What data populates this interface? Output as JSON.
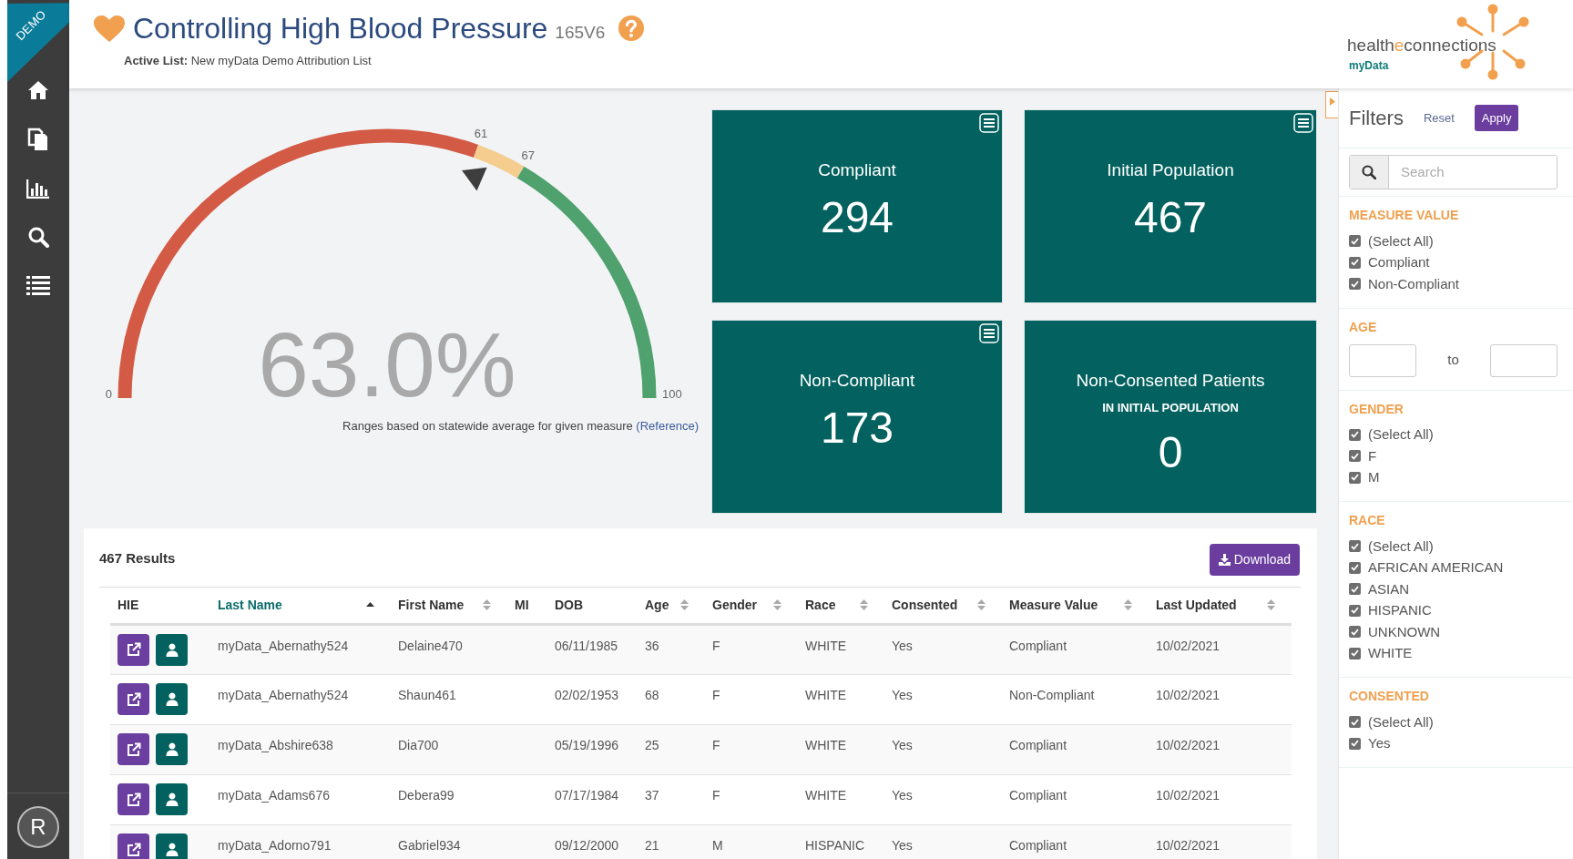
{
  "ribbon": "DEMO",
  "header": {
    "title": "Controlling High Blood Pressure",
    "code": "165V6",
    "active_list_label": "Active List:",
    "active_list": "New myData Demo Attribution List"
  },
  "logo": {
    "parts": [
      "health",
      "e",
      "connections"
    ],
    "sub": "myData"
  },
  "user": {
    "initial": "R"
  },
  "gauge": {
    "value_text": "63.0%",
    "level": 0.63,
    "start_label": "0",
    "bands": [
      {
        "end": "61",
        "color": "#d35a45"
      },
      {
        "end": "67",
        "color": "#f4cd8f"
      },
      {
        "end": "100",
        "color": "#4fa16d"
      }
    ],
    "caption": "Ranges based on statewide average for given measure",
    "link": "(Reference)"
  },
  "tiles": [
    {
      "label": "Compliant",
      "value": "294",
      "menu": true
    },
    {
      "label": "Initial Population",
      "value": "467",
      "menu": true
    },
    {
      "label": "Non-Compliant",
      "value": "173",
      "menu": true
    },
    {
      "label": "Non-Consented Patients",
      "sublabel": "IN INITIAL POPULATION",
      "value": "0",
      "menu": false
    }
  ],
  "results": {
    "count": "467 Results",
    "download": "Download"
  },
  "table": {
    "columns": [
      {
        "label": "HIE",
        "sortable": false,
        "sorted": false
      },
      {
        "label": "Last Name",
        "sortable": true,
        "sorted": true
      },
      {
        "label": "First Name",
        "sortable": true,
        "sorted": false
      },
      {
        "label": "MI",
        "sortable": false,
        "sorted": false
      },
      {
        "label": "DOB",
        "sortable": false,
        "sorted": false
      },
      {
        "label": "Age",
        "sortable": true,
        "sorted": false
      },
      {
        "label": "Gender",
        "sortable": true,
        "sorted": false
      },
      {
        "label": "Race",
        "sortable": true,
        "sorted": false
      },
      {
        "label": "Consented",
        "sortable": true,
        "sorted": false
      },
      {
        "label": "Measure Value",
        "sortable": true,
        "sorted": false
      },
      {
        "label": "Last Updated",
        "sortable": true,
        "sorted": false
      }
    ],
    "rows": [
      [
        "",
        "myData_Abernathy524",
        "Delaine470",
        "",
        "06/11/1985",
        "36",
        "F",
        "WHITE",
        "Yes",
        "Compliant",
        "10/02/2021"
      ],
      [
        "",
        "myData_Abernathy524",
        "Shaun461",
        "",
        "02/02/1953",
        "68",
        "F",
        "WHITE",
        "Yes",
        "Non-Compliant",
        "10/02/2021"
      ],
      [
        "",
        "myData_Abshire638",
        "Dia700",
        "",
        "05/19/1996",
        "25",
        "F",
        "WHITE",
        "Yes",
        "Compliant",
        "10/02/2021"
      ],
      [
        "",
        "myData_Adams676",
        "Debera99",
        "",
        "07/17/1984",
        "37",
        "F",
        "WHITE",
        "Yes",
        "Compliant",
        "10/02/2021"
      ],
      [
        "",
        "myData_Adorno791",
        "Gabriel934",
        "",
        "09/12/2000",
        "21",
        "M",
        "HISPANIC",
        "Yes",
        "Compliant",
        "10/02/2021"
      ]
    ]
  },
  "filters": {
    "title": "Filters",
    "reset": "Reset",
    "apply": "Apply",
    "search": {
      "placeholder": "Search"
    },
    "sections": [
      {
        "title": "MEASURE VALUE",
        "kind": "checklist",
        "options": [
          {
            "label": "(Select All)",
            "checked": true
          },
          {
            "label": "Compliant",
            "checked": true
          },
          {
            "label": "Non-Compliant",
            "checked": true
          }
        ]
      },
      {
        "title": "AGE",
        "kind": "range",
        "separator": "to"
      },
      {
        "title": "GENDER",
        "kind": "checklist",
        "options": [
          {
            "label": "(Select All)",
            "checked": true
          },
          {
            "label": "F",
            "checked": true
          },
          {
            "label": "M",
            "checked": true
          }
        ]
      },
      {
        "title": "RACE",
        "kind": "checklist",
        "options": [
          {
            "label": "(Select All)",
            "checked": true
          },
          {
            "label": "AFRICAN AMERICAN",
            "checked": true
          },
          {
            "label": "ASIAN",
            "checked": true
          },
          {
            "label": "HISPANIC",
            "checked": true
          },
          {
            "label": "UNKNOWN",
            "checked": true
          },
          {
            "label": "WHITE",
            "checked": true
          }
        ]
      },
      {
        "title": "CONSENTED",
        "kind": "checklist",
        "options": [
          {
            "label": "(Select All)",
            "checked": true
          },
          {
            "label": "Yes",
            "checked": true
          }
        ]
      }
    ]
  }
}
